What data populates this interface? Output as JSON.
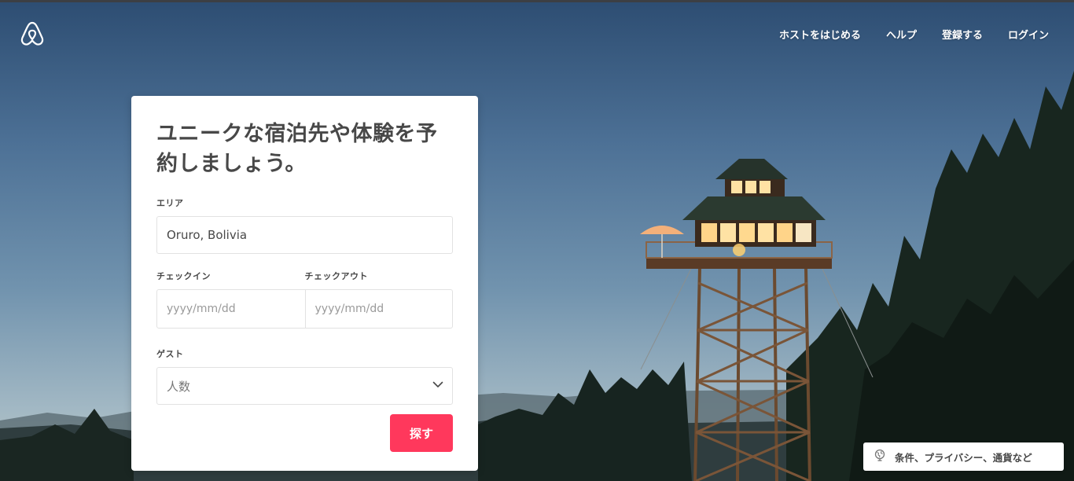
{
  "header": {
    "logo_icon": "airbnb-belo-icon",
    "nav": [
      {
        "label": "ホストをはじめる"
      },
      {
        "label": "ヘルプ"
      },
      {
        "label": "登録する"
      },
      {
        "label": "ログイン"
      }
    ]
  },
  "search_card": {
    "title": "ユニークな宿泊先や体験を予約しましょう。",
    "area": {
      "label": "エリア",
      "value": "Oruro, Bolivia"
    },
    "checkin": {
      "label": "チェックイン",
      "placeholder": "yyyy/mm/dd"
    },
    "checkout": {
      "label": "チェックアウト",
      "placeholder": "yyyy/mm/dd"
    },
    "guests": {
      "label": "ゲスト",
      "value": "人数"
    },
    "search_button": "探す",
    "accent_color": "#ff385c"
  },
  "footer": {
    "icon": "globe-icon",
    "label": "条件、プライバシー、通貨など"
  }
}
